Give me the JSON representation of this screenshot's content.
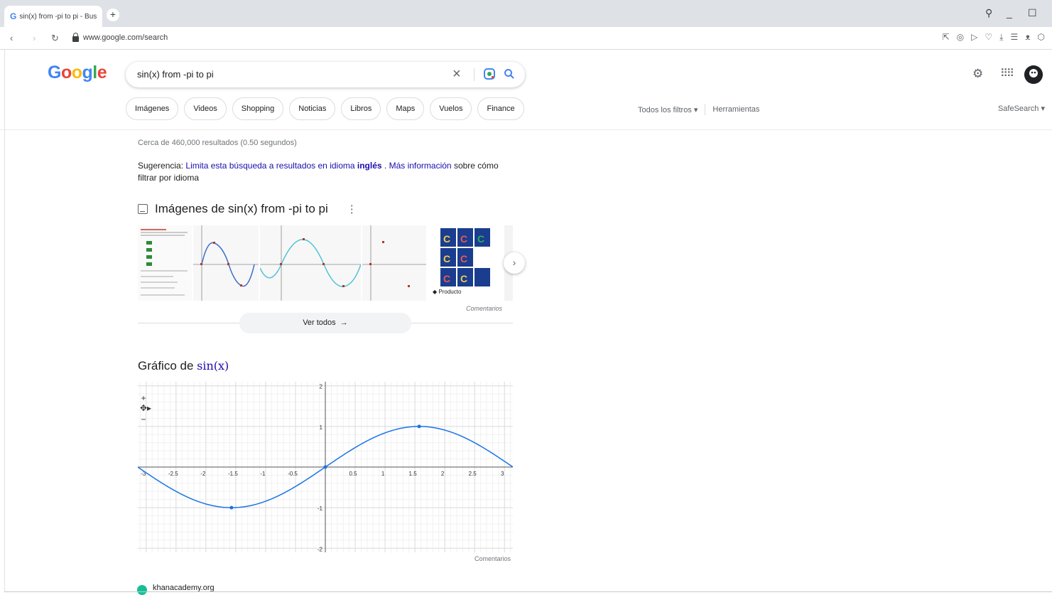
{
  "browser": {
    "tab_title": "sin(x) from -pi to pi - Bus",
    "new_tab": "+",
    "url": "www.google.com/search"
  },
  "google": {
    "logo": "Google",
    "logo_colors": [
      "#4285f4",
      "#ea4335",
      "#fbbc05",
      "#4285f4",
      "#34a853",
      "#ea4335"
    ],
    "query": "sin(x) from -pi to pi",
    "chips": [
      "Imágenes",
      "Videos",
      "Shopping",
      "Noticias",
      "Libros",
      "Maps",
      "Vuelos",
      "Finance"
    ],
    "all_filters": "Todos los filtros",
    "tools": "Herramientas",
    "safesearch": "SafeSearch"
  },
  "results": {
    "stats": "Cerca de 460,000 resultados (0.50 segundos)",
    "suggestion_prefix": "Sugerencia: ",
    "suggestion_link": "Limita esta búsqueda a resultados en idioma ",
    "suggestion_bold": "inglés",
    "suggestion_mid": " . ",
    "suggestion_more": "Más información",
    "suggestion_tail": " sobre cómo filtrar por idioma",
    "images_heading": "Imágenes de sin(x) from -pi to pi",
    "product_badge": "Producto",
    "comments": "Comentarios",
    "see_all": "Ver todos",
    "graph_heading": "Gráfico de ",
    "graph_math": "sin(x)",
    "graph_comments": "Comentarios",
    "source": "khanacademy.org"
  },
  "chart_data": {
    "type": "line",
    "function": "sin(x)",
    "x_ticks": [
      "-3",
      "-2.5",
      "-2",
      "-1.5",
      "-1",
      "-0.5",
      "0.5",
      "1",
      "1.5",
      "2",
      "2.5",
      "3"
    ],
    "y_ticks": [
      "2",
      "1",
      "-1",
      "-2"
    ],
    "xlim": [
      -3.14,
      3.14
    ],
    "ylim": [
      -2.1,
      2.1
    ],
    "points": [
      {
        "x": -1.571,
        "y": -1
      },
      {
        "x": 0,
        "y": 0
      },
      {
        "x": 1.571,
        "y": 1
      }
    ],
    "line_color": "#1a73e8",
    "grid": true,
    "controls": [
      "+",
      "−"
    ]
  }
}
